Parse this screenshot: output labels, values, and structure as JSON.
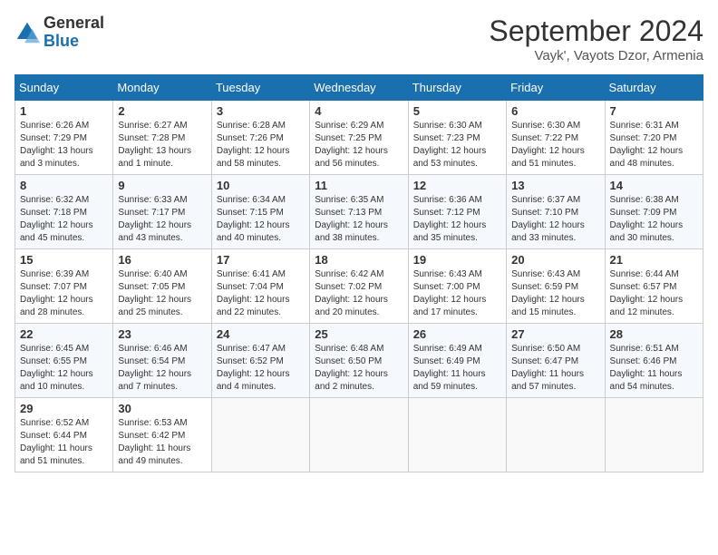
{
  "header": {
    "logo_general": "General",
    "logo_blue": "Blue",
    "month_title": "September 2024",
    "subtitle": "Vayk', Vayots Dzor, Armenia"
  },
  "weekdays": [
    "Sunday",
    "Monday",
    "Tuesday",
    "Wednesday",
    "Thursday",
    "Friday",
    "Saturday"
  ],
  "weeks": [
    [
      {
        "day": "1",
        "info": "Sunrise: 6:26 AM\nSunset: 7:29 PM\nDaylight: 13 hours and 3 minutes."
      },
      {
        "day": "2",
        "info": "Sunrise: 6:27 AM\nSunset: 7:28 PM\nDaylight: 13 hours and 1 minute."
      },
      {
        "day": "3",
        "info": "Sunrise: 6:28 AM\nSunset: 7:26 PM\nDaylight: 12 hours and 58 minutes."
      },
      {
        "day": "4",
        "info": "Sunrise: 6:29 AM\nSunset: 7:25 PM\nDaylight: 12 hours and 56 minutes."
      },
      {
        "day": "5",
        "info": "Sunrise: 6:30 AM\nSunset: 7:23 PM\nDaylight: 12 hours and 53 minutes."
      },
      {
        "day": "6",
        "info": "Sunrise: 6:30 AM\nSunset: 7:22 PM\nDaylight: 12 hours and 51 minutes."
      },
      {
        "day": "7",
        "info": "Sunrise: 6:31 AM\nSunset: 7:20 PM\nDaylight: 12 hours and 48 minutes."
      }
    ],
    [
      {
        "day": "8",
        "info": "Sunrise: 6:32 AM\nSunset: 7:18 PM\nDaylight: 12 hours and 45 minutes."
      },
      {
        "day": "9",
        "info": "Sunrise: 6:33 AM\nSunset: 7:17 PM\nDaylight: 12 hours and 43 minutes."
      },
      {
        "day": "10",
        "info": "Sunrise: 6:34 AM\nSunset: 7:15 PM\nDaylight: 12 hours and 40 minutes."
      },
      {
        "day": "11",
        "info": "Sunrise: 6:35 AM\nSunset: 7:13 PM\nDaylight: 12 hours and 38 minutes."
      },
      {
        "day": "12",
        "info": "Sunrise: 6:36 AM\nSunset: 7:12 PM\nDaylight: 12 hours and 35 minutes."
      },
      {
        "day": "13",
        "info": "Sunrise: 6:37 AM\nSunset: 7:10 PM\nDaylight: 12 hours and 33 minutes."
      },
      {
        "day": "14",
        "info": "Sunrise: 6:38 AM\nSunset: 7:09 PM\nDaylight: 12 hours and 30 minutes."
      }
    ],
    [
      {
        "day": "15",
        "info": "Sunrise: 6:39 AM\nSunset: 7:07 PM\nDaylight: 12 hours and 28 minutes."
      },
      {
        "day": "16",
        "info": "Sunrise: 6:40 AM\nSunset: 7:05 PM\nDaylight: 12 hours and 25 minutes."
      },
      {
        "day": "17",
        "info": "Sunrise: 6:41 AM\nSunset: 7:04 PM\nDaylight: 12 hours and 22 minutes."
      },
      {
        "day": "18",
        "info": "Sunrise: 6:42 AM\nSunset: 7:02 PM\nDaylight: 12 hours and 20 minutes."
      },
      {
        "day": "19",
        "info": "Sunrise: 6:43 AM\nSunset: 7:00 PM\nDaylight: 12 hours and 17 minutes."
      },
      {
        "day": "20",
        "info": "Sunrise: 6:43 AM\nSunset: 6:59 PM\nDaylight: 12 hours and 15 minutes."
      },
      {
        "day": "21",
        "info": "Sunrise: 6:44 AM\nSunset: 6:57 PM\nDaylight: 12 hours and 12 minutes."
      }
    ],
    [
      {
        "day": "22",
        "info": "Sunrise: 6:45 AM\nSunset: 6:55 PM\nDaylight: 12 hours and 10 minutes."
      },
      {
        "day": "23",
        "info": "Sunrise: 6:46 AM\nSunset: 6:54 PM\nDaylight: 12 hours and 7 minutes."
      },
      {
        "day": "24",
        "info": "Sunrise: 6:47 AM\nSunset: 6:52 PM\nDaylight: 12 hours and 4 minutes."
      },
      {
        "day": "25",
        "info": "Sunrise: 6:48 AM\nSunset: 6:50 PM\nDaylight: 12 hours and 2 minutes."
      },
      {
        "day": "26",
        "info": "Sunrise: 6:49 AM\nSunset: 6:49 PM\nDaylight: 11 hours and 59 minutes."
      },
      {
        "day": "27",
        "info": "Sunrise: 6:50 AM\nSunset: 6:47 PM\nDaylight: 11 hours and 57 minutes."
      },
      {
        "day": "28",
        "info": "Sunrise: 6:51 AM\nSunset: 6:46 PM\nDaylight: 11 hours and 54 minutes."
      }
    ],
    [
      {
        "day": "29",
        "info": "Sunrise: 6:52 AM\nSunset: 6:44 PM\nDaylight: 11 hours and 51 minutes."
      },
      {
        "day": "30",
        "info": "Sunrise: 6:53 AM\nSunset: 6:42 PM\nDaylight: 11 hours and 49 minutes."
      },
      {
        "day": "",
        "info": ""
      },
      {
        "day": "",
        "info": ""
      },
      {
        "day": "",
        "info": ""
      },
      {
        "day": "",
        "info": ""
      },
      {
        "day": "",
        "info": ""
      }
    ]
  ]
}
